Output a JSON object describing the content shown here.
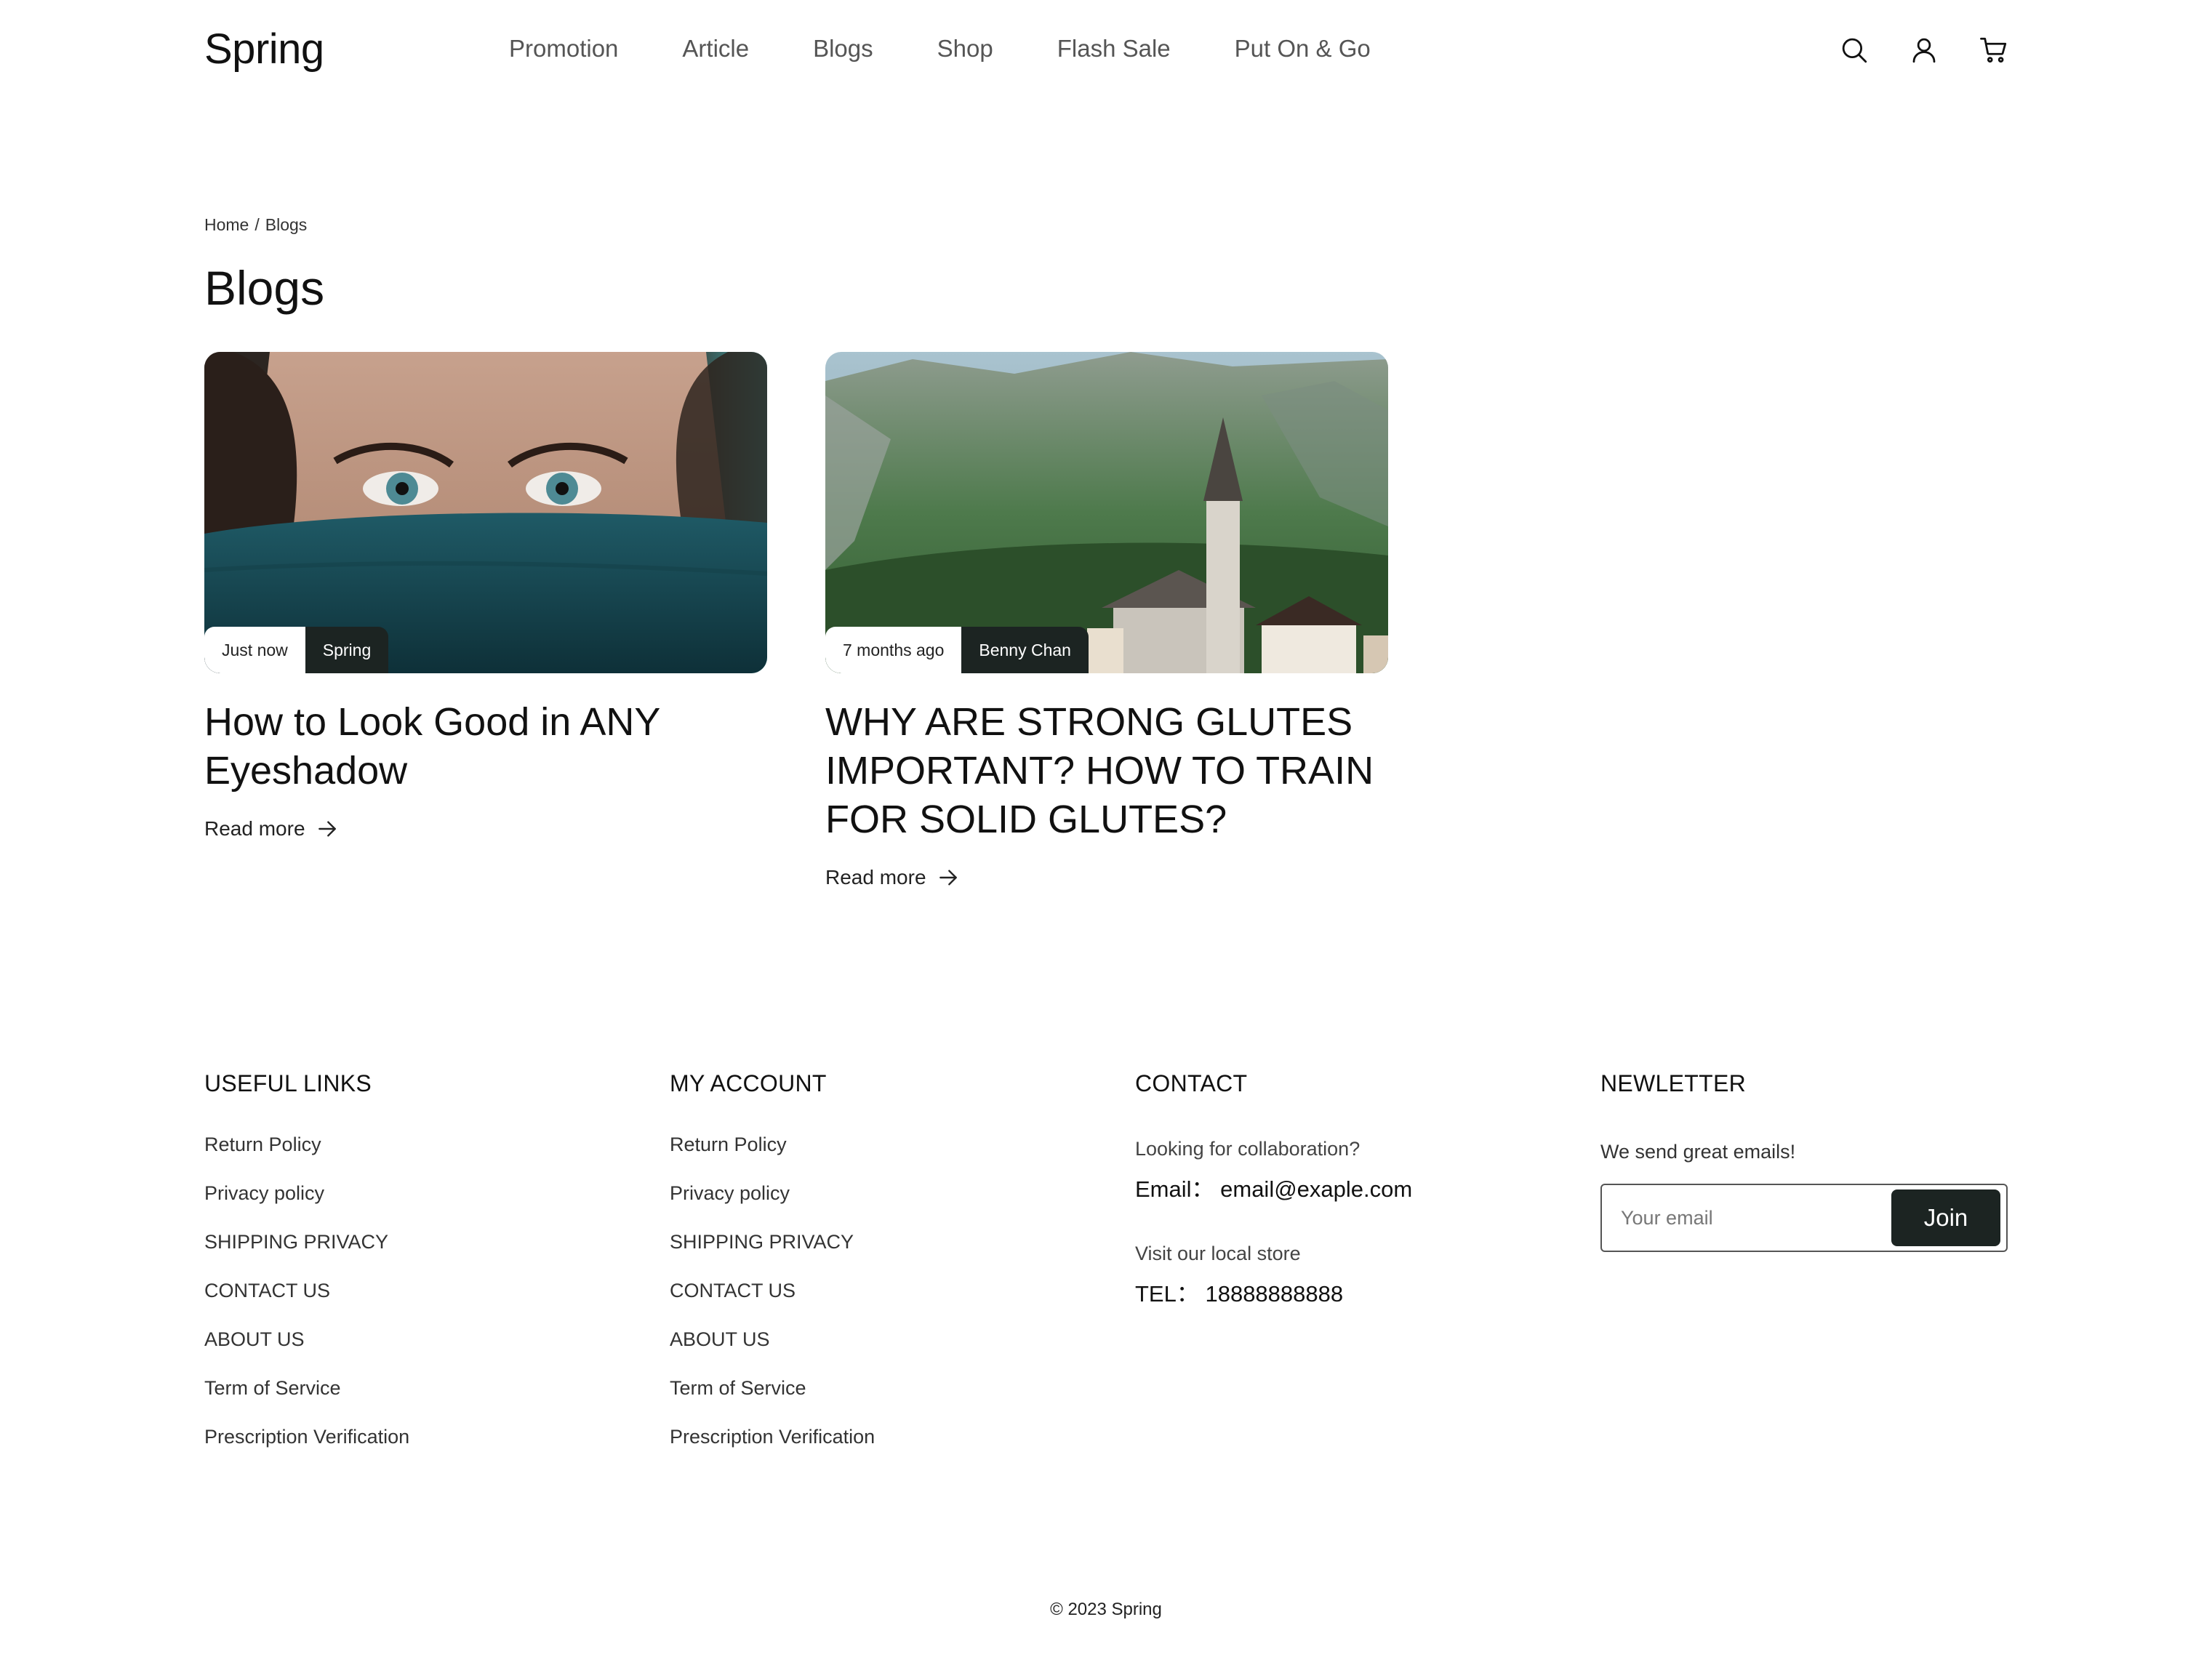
{
  "header": {
    "logo": "Spring",
    "nav": [
      "Promotion",
      "Article",
      "Blogs",
      "Shop",
      "Flash Sale",
      "Put On & Go"
    ],
    "icons": [
      "search-icon",
      "user-icon",
      "cart-icon"
    ]
  },
  "breadcrumb": {
    "home": "Home",
    "separator": "/",
    "current": "Blogs"
  },
  "page_title": "Blogs",
  "posts": [
    {
      "date": "Just now",
      "author": "Spring",
      "title": "How to Look Good in ANY Eyeshadow",
      "read_more": "Read more"
    },
    {
      "date": "7 months ago",
      "author": "Benny Chan",
      "title": "WHY ARE STRONG GLUTES IMPORTANT? HOW TO TRAIN FOR SOLID GLUTES?",
      "read_more": "Read more"
    }
  ],
  "footer": {
    "useful_links": {
      "heading": "USEFUL LINKS",
      "items": [
        "Return Policy",
        "Privacy policy",
        "SHIPPING PRIVACY",
        "CONTACT US",
        "ABOUT US",
        "Term of Service",
        "Prescription Verification"
      ]
    },
    "my_account": {
      "heading": "MY ACCOUNT",
      "items": [
        "Return Policy",
        "Privacy policy",
        "SHIPPING PRIVACY",
        "CONTACT US",
        "ABOUT US",
        "Term of Service",
        "Prescription Verification"
      ]
    },
    "contact": {
      "heading": "CONTACT",
      "collab_label": "Looking for collaboration?",
      "email": "Email： email@exaple.com",
      "store_label": "Visit our local store",
      "tel": "TEL： 18888888888"
    },
    "newsletter": {
      "heading": "NEWLETTER",
      "text": "We send great emails!",
      "placeholder": "Your email",
      "button": "Join"
    }
  },
  "copyright": "© 2023 Spring",
  "colors": {
    "accent_dark": "#1c2422",
    "text": "#111111",
    "nav_text": "#555555"
  }
}
